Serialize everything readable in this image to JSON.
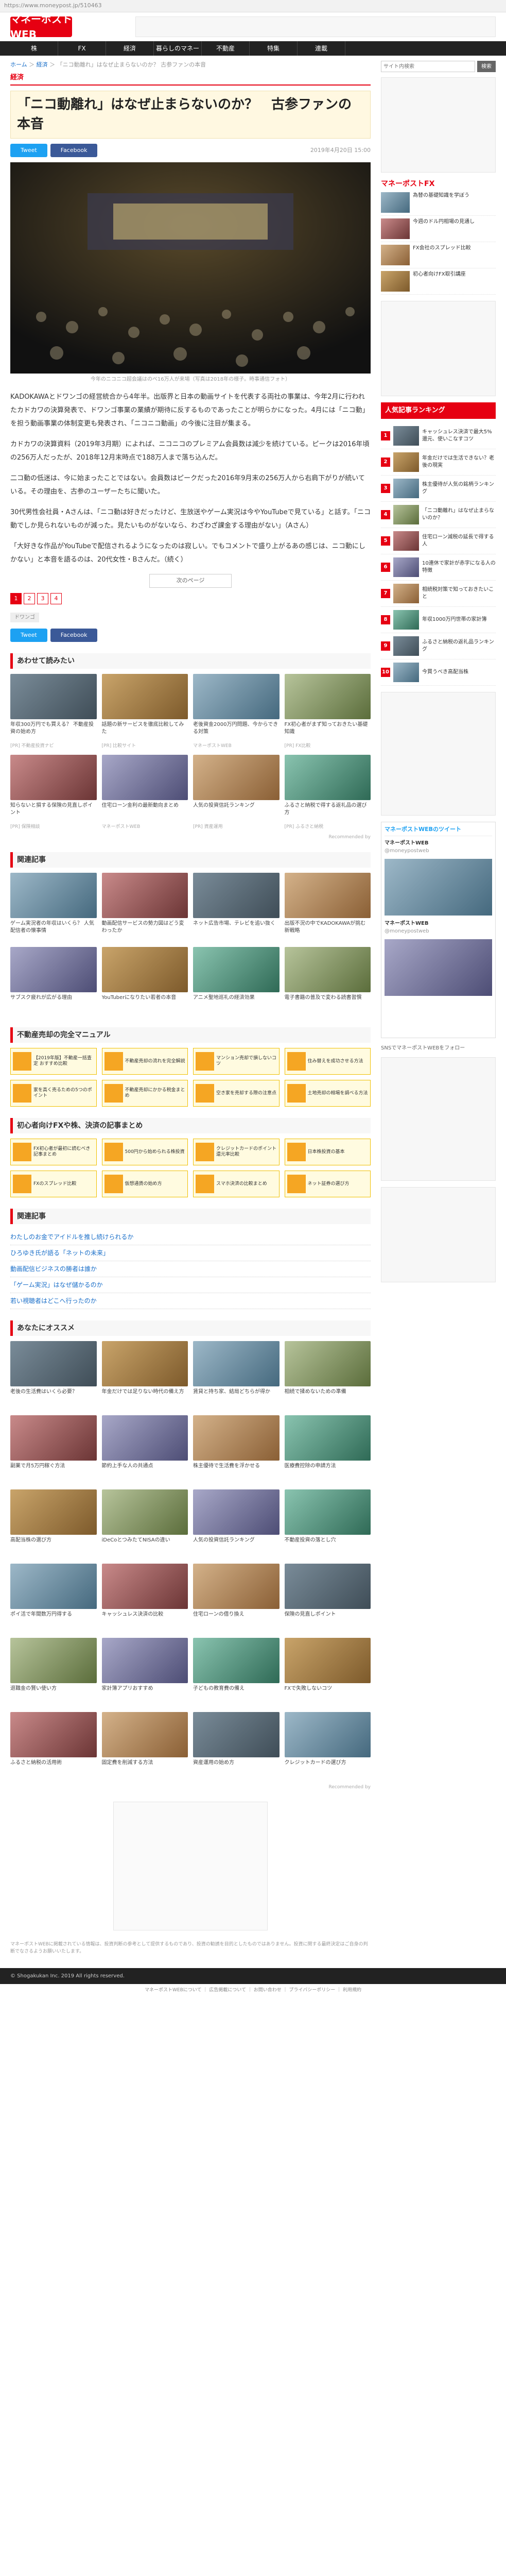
{
  "browser": {
    "url": "https://www.moneypost.jp/510463"
  },
  "header": {
    "logo": "マネーポスト WEB"
  },
  "nav": [
    "株",
    "FX",
    "経済",
    "暮らしのマネー",
    "不動産",
    "特集",
    "連載"
  ],
  "breadcrumb": {
    "home": "ホーム",
    "sep": "＞",
    "cat": "経済",
    "page": "「ニコ動離れ」はなぜ止まらないのか？ 古参ファンの本音"
  },
  "article": {
    "category": "経済",
    "title": "「ニコ動離れ」はなぜ止まらないのか？　古参ファンの本音",
    "tweet": "Tweet",
    "facebook": "Facebook",
    "date": "2019年4月20日 15:00",
    "hero_caption": "今年のニコニコ超会議はのべ16万人が来場（写真は2018年の様子。時事通信フォト）",
    "paragraphs": [
      "KADOKAWAとドワンゴの経営統合から4年半。出版界と日本の動画サイトを代表する両社の事業は、今年2月に行われたカドカワの決算発表で、ドワンゴ事業の業績が期待に反するものであったことが明らかになった。4月には「ニコ動」を担う動画事業の体制変更も発表され、「ニコニコ動画」の今後に注目が集まる。",
      "カドカワの決算資料（2019年3月期）によれば、ニコニコのプレミアム会員数は減少を続けている。ピークは2016年頃の256万人だったが、2018年12月末時点で188万人まで落ち込んだ。",
      "二コ動の低迷は、今に始まったことではない。会員数はピークだった2016年9月末の256万人から右肩下がりが続いている。その理由を、古参のユーザーたちに聞いた。",
      "30代男性会社員・Aさんは、「ニコ動は好きだったけど、生放送やゲーム実況は今やYouTubeで見ている」と話す。「ニコ動でしか見られないものが減った。見たいものがないなら、わざわざ課金する理由がない」（Aさん）",
      "「大好きな作品がYouTubeで配信されるようになったのは寂しい。でもコメントで盛り上がるあの感じは、ニコ動にしかない」と本音を語るのは、20代女性・Bさんだ。（続く）"
    ],
    "pages": [
      "1",
      "2",
      "3",
      "4"
    ],
    "next": "次のページ",
    "tag": "ドワンゴ"
  },
  "sections": {
    "related_read": "あわせて読みたい",
    "related": "関連記事",
    "realestate": "不動産売却の完全マニュアル",
    "fx_guide": "初心者向けFXや株、決済の記事まとめ",
    "related2": "関連記事",
    "recommend": "あなたにオススメ"
  },
  "read_cards": [
    {
      "cap": "年収300万円でも買える？ 不動産投資の始め方",
      "src": "[PR] 不動産投資ナビ"
    },
    {
      "cap": "話題の新サービスを徹底比較してみた",
      "src": "[PR] 比較サイト"
    },
    {
      "cap": "老後資金2000万円問題、今からできる対策",
      "src": "マネーポストWEB"
    },
    {
      "cap": "FX初心者がまず知っておきたい基礎知識",
      "src": "[PR] FX比較"
    },
    {
      "cap": "知らないと損する保険の見直しポイント",
      "src": "[PR] 保険相談"
    },
    {
      "cap": "住宅ローン金利の最新動向まとめ",
      "src": "マネーポストWEB"
    },
    {
      "cap": "人気の投資信託ランキング",
      "src": "[PR] 資産運用"
    },
    {
      "cap": "ふるさと納税で得する返礼品の選び方",
      "src": "[PR] ふるさと納税"
    }
  ],
  "recommended_by": "Recommended by",
  "related_cards": [
    {
      "cap": "ゲーム実況者の年収はいくら？ 人気配信者の懐事情"
    },
    {
      "cap": "動画配信サービスの勢力図はどう変わったか"
    },
    {
      "cap": "ネット広告市場、テレビを追い抜く"
    },
    {
      "cap": "出版不況の中でKADOKAWAが挑む新戦略"
    },
    {
      "cap": "サブスク疲れが広がる理由"
    },
    {
      "cap": "YouTuberになりたい若者の本音"
    },
    {
      "cap": "アニメ聖地巡礼の経済効果"
    },
    {
      "cap": "電子書籍の普及で変わる読書習慣"
    }
  ],
  "realestate_boxes": [
    "【2019年版】不動産一括査定 おすすめ比較",
    "不動産売却の流れを完全解説",
    "マンション売却で損しないコツ",
    "住み替えを成功させる方法",
    "家を高く売るための5つのポイント",
    "不動産売却にかかる税金まとめ",
    "空き家を売却する際の注意点",
    "土地売却の相場を調べる方法"
  ],
  "fx_boxes": [
    "FX初心者が最初に読むべき記事まとめ",
    "500円から始められる株投資",
    "クレジットカードのポイント還元率比較",
    "日本株投資の基本",
    "FXのスプレッド比較",
    "仮想通貨の始め方",
    "スマホ決済の比較まとめ",
    "ネット証券の選び方"
  ],
  "related_links": [
    "わたしのお金でアイドルを推し続けられるか",
    "ひろゆき氏が語る「ネットの未来」",
    "動画配信ビジネスの勝者は誰か",
    "「ゲーム実況」はなぜ儲かるのか",
    "若い視聴者はどこへ行ったのか"
  ],
  "recommend_cards": [
    {
      "cap": "老後の生活費はいくら必要？"
    },
    {
      "cap": "年金だけでは足りない時代の備え方"
    },
    {
      "cap": "賃貸と持ち家、結局どちらが得か"
    },
    {
      "cap": "相続で揉めないための準備"
    },
    {
      "cap": "副業で月5万円稼ぐ方法"
    },
    {
      "cap": "節約上手な人の共通点"
    },
    {
      "cap": "株主優待で生活費を浮かせる"
    },
    {
      "cap": "医療費控除の申請方法"
    },
    {
      "cap": "高配当株の選び方"
    },
    {
      "cap": "iDeCoとつみたてNISAの違い"
    },
    {
      "cap": "人気の投資信託ランキング"
    },
    {
      "cap": "不動産投資の落とし穴"
    },
    {
      "cap": "ポイ活で年間数万円得する"
    },
    {
      "cap": "キャッシュレス決済の比較"
    },
    {
      "cap": "住宅ローンの借り換え"
    },
    {
      "cap": "保険の見直しポイント"
    },
    {
      "cap": "退職金の賢い使い方"
    },
    {
      "cap": "家計簿アプリおすすめ"
    },
    {
      "cap": "子どもの教育費の備え"
    },
    {
      "cap": "FXで失敗しないコツ"
    },
    {
      "cap": "ふるさと納税の活用術"
    },
    {
      "cap": "固定費を削減する方法"
    },
    {
      "cap": "資産運用の始め方"
    },
    {
      "cap": "クレジットカードの選び方"
    }
  ],
  "footnote": "マネーポストWEBに掲載されている情報は、投資判断の参考として提供するものであり、投資の勧誘を目的としたものではありません。投資に関する最終決定はご自身の判断でなさるようお願いいたします。",
  "footer": {
    "copyright": "© Shogakukan Inc. 2019 All rights reserved.",
    "links": "マネーポストWEBについて ｜ 広告掲載について ｜ お問い合わせ ｜ プライバシーポリシー ｜ 利用規約"
  },
  "sidebar": {
    "search_placeholder": "サイト内検索",
    "search_btn": "検索",
    "fx_head": "マネーポストFX",
    "fx_items": [
      "為替の基礎知識を学ぼう",
      "今週のドル円相場の見通し",
      "FX会社のスプレッド比較",
      "初心者向けFX取引講座"
    ],
    "ranking_head": "人気記事ランキング",
    "ranking": [
      {
        "no": "1",
        "t": "キャッシュレス決済で最大5%還元、使いこなすコツ"
      },
      {
        "no": "2",
        "t": "年金だけでは生活できない？老後の現実"
      },
      {
        "no": "3",
        "t": "株主優待が人気の銘柄ランキング"
      },
      {
        "no": "4",
        "t": "「ニコ動離れ」はなぜ止まらないのか？"
      },
      {
        "no": "5",
        "t": "住宅ローン減税の延長で得する人"
      },
      {
        "no": "6",
        "t": "10連休で家計が赤字になる人の特徴"
      },
      {
        "no": "7",
        "t": "相続税対策で知っておきたいこと"
      },
      {
        "no": "8",
        "t": "年収1000万円世帯の家計簿"
      },
      {
        "no": "9",
        "t": "ふるさと納税の返礼品ランキング"
      },
      {
        "no": "10",
        "t": "今買うべき高配当株"
      }
    ],
    "twitter_head": "マネーポストWEBのツイート",
    "twitter_follow": "SNSでマネーポストWEBをフォロー",
    "twitter_user": "マネーポストWEB",
    "twitter_handle": "@moneypostweb"
  }
}
